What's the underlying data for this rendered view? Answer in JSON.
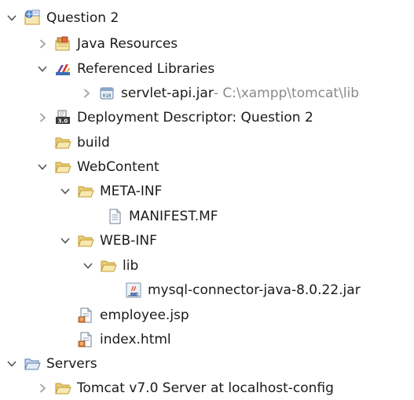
{
  "tree": {
    "project": {
      "label": "Question 2"
    },
    "java_resources": {
      "label": "Java Resources"
    },
    "referenced_libraries": {
      "label": "Referenced Libraries"
    },
    "servlet_api": {
      "label": "servlet-api.jar",
      "decoration": " - C:\\xampp\\tomcat\\lib"
    },
    "deployment_descriptor": {
      "label": "Deployment Descriptor: Question 2"
    },
    "build": {
      "label": "build"
    },
    "webcontent": {
      "label": "WebContent"
    },
    "meta_inf": {
      "label": "META-INF"
    },
    "manifest": {
      "label": "MANIFEST.MF"
    },
    "web_inf": {
      "label": "WEB-INF"
    },
    "lib": {
      "label": "lib"
    },
    "mysql_connector": {
      "label": "mysql-connector-java-8.0.22.jar"
    },
    "employee_jsp": {
      "label": "employee.jsp"
    },
    "index_html": {
      "label": "index.html"
    },
    "servers": {
      "label": "Servers"
    },
    "tomcat_config": {
      "label": "Tomcat v7.0 Server at localhost-config"
    }
  },
  "colors": {
    "folder_fill": "#f7e8b3",
    "folder_stroke": "#c49a2c",
    "arrow": "#555555",
    "arrow_collapsed": "#9a9a9a",
    "decoration_text": "#8a8a8a"
  }
}
